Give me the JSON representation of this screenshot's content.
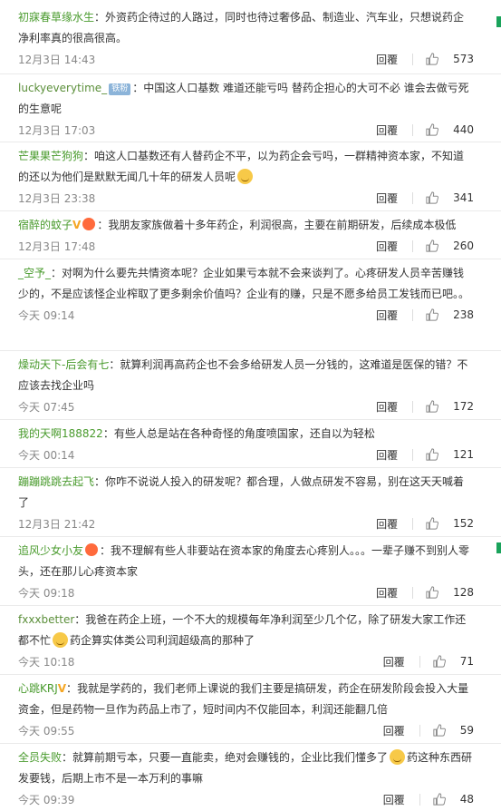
{
  "reply_label": "回覆",
  "comments": [
    {
      "user": "初寐春草缘水生",
      "colon": "：",
      "text": "外资药企待过的人路过，同时也待过奢侈品、制造业、汽车业，只想说药企净利率真的很高很高。",
      "date": "12月3日 14:43",
      "likes": "573"
    },
    {
      "user": "luckyeverytime_",
      "badge": "铁粉",
      "colon": "：",
      "text": "中国这人口基数 难道还能亏吗 替药企担心的大可不必 谁会去做亏死的生意呢",
      "date": "12月3日 17:03",
      "likes": "440"
    },
    {
      "user": "芒果果芒狗狗",
      "colon": "：",
      "text": "咱这人口基数还有人替药企不平，以为药企会亏吗，一群精神资本家，不知道的还以为他们是默默无闻几十年的研发人员呢",
      "date": "12月3日 23:38",
      "likes": "341"
    },
    {
      "user": "宿醉的蚊子",
      "colon": "：",
      "text": "我朋友家族做着十多年药企，利润很高，主要在前期研发，后续成本极低",
      "date": "12月3日 17:48",
      "likes": "260"
    },
    {
      "user": "_空予_",
      "colon": "：",
      "text": "对啊为什么要先共情资本呢？企业如果亏本就不会来谈判了。心疼研发人员辛苦赚钱少的，不是应该怪企业榨取了更多剩余价值吗？企业有的赚，只是不愿多给员工发钱而已吧。。",
      "date": "今天 09:14",
      "likes": "238"
    },
    {
      "user": "燥动天下-后会有七",
      "colon": "：",
      "text": "就算利润再高药企也不会多给研发人员一分钱的，这难道是医保的错？不应该去找企业吗",
      "date": "今天 07:45",
      "likes": "172"
    },
    {
      "user": "我的天啊188822",
      "colon": "：",
      "text": "有些人总是站在各种奇怪的角度喷国家，还自以为轻松",
      "date": "今天 00:14",
      "likes": "121"
    },
    {
      "user": "蹦蹦跳跳去起飞",
      "colon": "：",
      "text": "你咋不说说人投入的研发呢？都合理，人做点研发不容易，别在这天天喊着了",
      "date": "12月3日 21:42",
      "likes": "152"
    },
    {
      "user": "追风少女小友",
      "colon": "：",
      "text": "我不理解有些人非要站在资本家的角度去心疼别人。。。一辈子赚不到别人零头，还在那儿心疼资本家",
      "date": "今天 09:18",
      "likes": "128"
    },
    {
      "user": "fxxxbetter",
      "colon": "：",
      "text": "我爸在药企上班，一个不大的规模每年净利润至少几个亿，除了研发大家工作还都不忙",
      "text_after": "药企算实体类公司利润超级高的那种了",
      "date": "今天 10:18",
      "likes": "71"
    },
    {
      "user": "心跳KRJ",
      "colon": "：",
      "text": "我就是学药的，我们老师上课说的我们主要是搞研发，药企在研发阶段会投入大量资金，但是药物一旦作为药品上市了，短时间内不仅能回本，利润还能翻几倍",
      "date": "今天 09:55",
      "likes": "59"
    },
    {
      "user": "全员失败",
      "colon": "：",
      "text": "就算前期亏本，只要一直能卖，绝对会赚钱的，企业比我们懂多了",
      "text_after": "药这种东西研发要钱，后期上市不是一本万利的事嘛",
      "date": "今天 09:39",
      "likes": "48"
    }
  ]
}
